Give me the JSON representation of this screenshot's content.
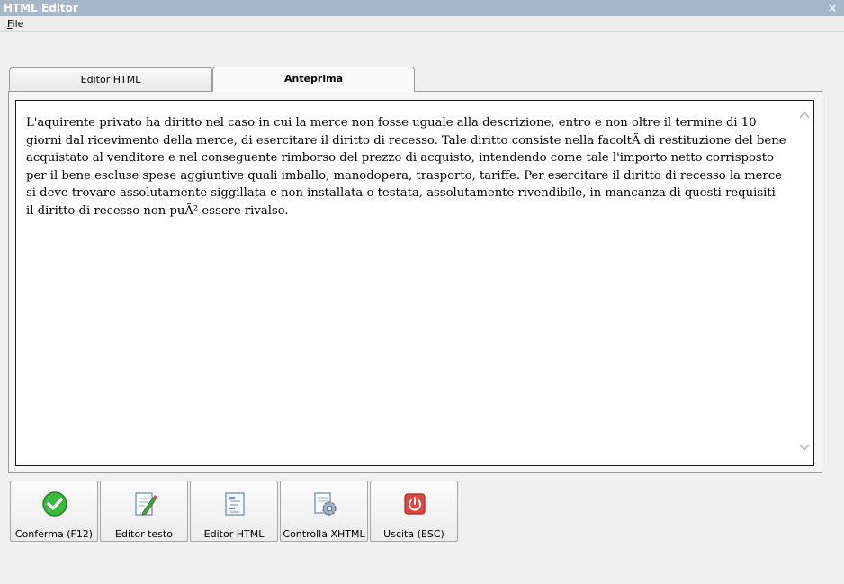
{
  "window": {
    "title": "HTML Editor",
    "close_glyph": "×"
  },
  "menu": {
    "file_accel": "F",
    "file_rest": "ile"
  },
  "tabs": [
    {
      "label": "Editor HTML",
      "selected": false
    },
    {
      "label": "Anteprima",
      "selected": true
    }
  ],
  "preview": {
    "text": "L'aquirente privato ha diritto nel caso in cui la merce non fosse uguale alla descrizione, entro e non oltre il termine di 10 giorni dal ricevimento della merce, di esercitare il diritto di recesso. Tale diritto consiste nella facoltÃ  di restituzione del bene acquistato al venditore e nel conseguente rimborso del prezzo di acquisto, intendendo come tale l'importo netto corrisposto per il bene escluse spese aggiuntive quali imballo, manodopera, trasporto, tariffe. Per esercitare il diritto di recesso la merce si deve trovare assolutamente siggillata e non installata o testata, assolutamente rivendibile, in mancanza di questi requisiti il diritto di recesso non puÃ² essere rivalso."
  },
  "buttons": [
    {
      "label": "Conferma (F12)",
      "icon": "check-icon"
    },
    {
      "label": "Editor testo",
      "icon": "edit-document-icon"
    },
    {
      "label": "Editor HTML",
      "icon": "html-document-icon"
    },
    {
      "label": "Controlla XHTML",
      "icon": "validate-gear-icon"
    },
    {
      "label": "Uscita (ESC)",
      "icon": "exit-power-icon"
    }
  ],
  "colors": {
    "titlebar": "#a7b6c9",
    "confirm_green": "#3cb83c",
    "exit_red": "#e2453c"
  }
}
